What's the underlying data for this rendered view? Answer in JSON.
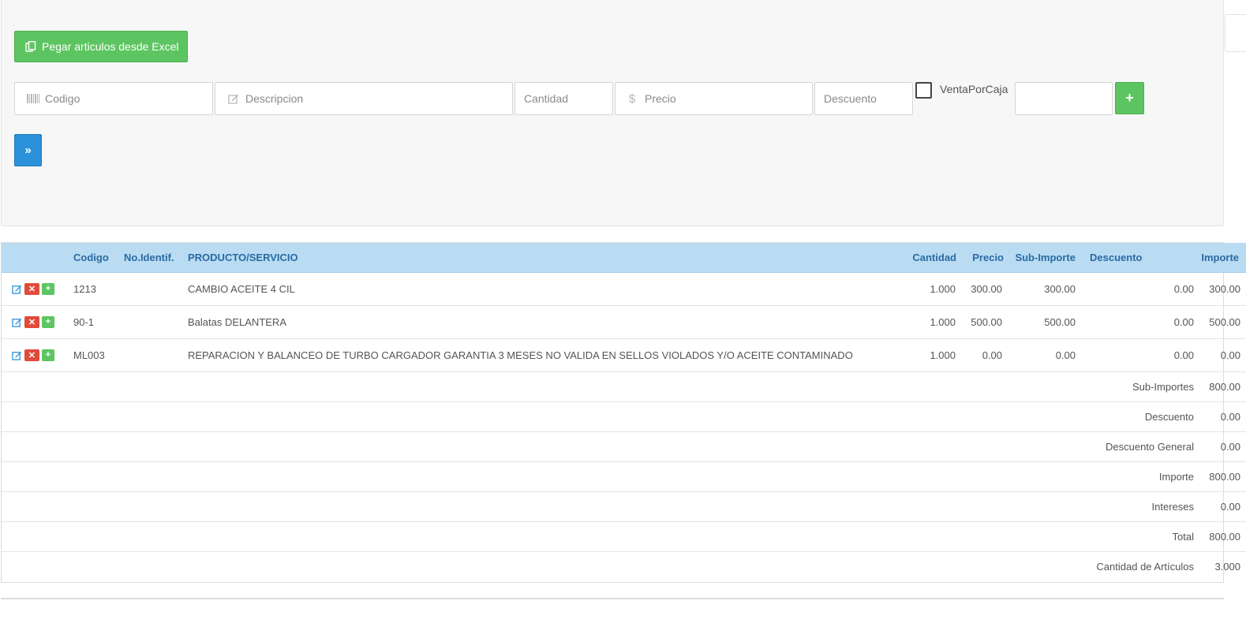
{
  "toolbar": {
    "paste_excel_label": "Pegar articulos desde Excel"
  },
  "entry_form": {
    "codigo_placeholder": "Codigo",
    "descripcion_placeholder": "Descripcion",
    "cantidad_placeholder": "Cantidad",
    "precio_placeholder": "Precio",
    "precio_symbol": "$",
    "descuento_placeholder": "Descuento",
    "venta_por_caja_label": "VentaPorCaja",
    "venta_por_caja_checked": false,
    "extra_value": "",
    "add_label": "+",
    "next_label": "»"
  },
  "table": {
    "headers": {
      "codigo": "Codigo",
      "no_identif": "No.Identif.",
      "producto": "PRODUCTO/SERVICIO",
      "cantidad": "Cantidad",
      "precio": "Precio",
      "sub_importe": "Sub-Importe",
      "descuento": "Descuento",
      "importe": "Importe"
    },
    "rows": [
      {
        "codigo": "1213",
        "no_identif": "",
        "producto": "CAMBIO ACEITE 4 CIL",
        "cantidad": "1.000",
        "precio": "300.00",
        "sub_importe": "300.00",
        "descuento": "0.00",
        "importe": "300.00"
      },
      {
        "codigo": "90-1",
        "no_identif": "",
        "producto": "Balatas DELANTERA",
        "cantidad": "1.000",
        "precio": "500.00",
        "sub_importe": "500.00",
        "descuento": "0.00",
        "importe": "500.00"
      },
      {
        "codigo": "ML003",
        "no_identif": "",
        "producto": "REPARACION Y BALANCEO DE TURBO CARGADOR GARANTIA 3 MESES NO VALIDA EN SELLOS VIOLADOS Y/O ACEITE CONTAMINADO",
        "cantidad": "1.000",
        "precio": "0.00",
        "sub_importe": "0.00",
        "descuento": "0.00",
        "importe": "0.00"
      }
    ],
    "row_actions": {
      "add_label": "+"
    },
    "summary": [
      {
        "label": "Sub-Importes",
        "value": "800.00"
      },
      {
        "label": "Descuento",
        "value": "0.00"
      },
      {
        "label": "Descuento General",
        "value": "0.00"
      },
      {
        "label": "Importe",
        "value": "800.00"
      },
      {
        "label": "Intereses",
        "value": "0.00"
      },
      {
        "label": "Total",
        "value": "800.00"
      },
      {
        "label": "Cantidad de Artículos",
        "value": "3.000"
      }
    ]
  },
  "colors": {
    "success_green": "#5cc561",
    "primary_blue": "#2b91db",
    "danger_red": "#e04b3a",
    "header_bg": "#b9dcf3",
    "header_text": "#2a6aa3"
  }
}
